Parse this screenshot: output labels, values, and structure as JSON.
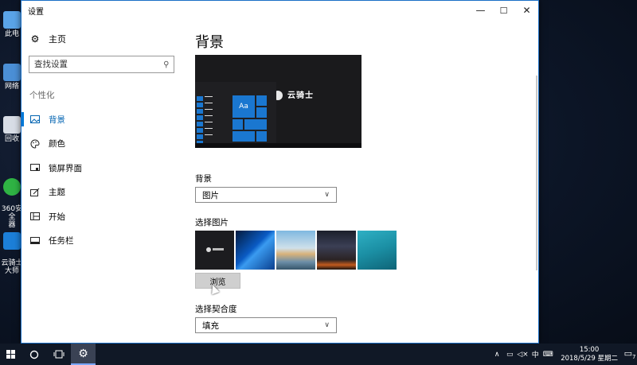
{
  "window": {
    "title": "设置",
    "controls": [
      "minimize-icon",
      "maximize-icon",
      "close-icon"
    ]
  },
  "sidebar": {
    "home_label": "主页",
    "search_placeholder": "查找设置",
    "section_label": "个性化",
    "items": [
      {
        "label": "背景",
        "icon": "picture-icon",
        "active": true
      },
      {
        "label": "颜色",
        "icon": "palette-icon",
        "active": false
      },
      {
        "label": "锁屏界面",
        "icon": "lock-screen-icon",
        "active": false
      },
      {
        "label": "主题",
        "icon": "theme-brush-icon",
        "active": false
      },
      {
        "label": "开始",
        "icon": "start-grid-icon",
        "active": false
      },
      {
        "label": "任务栏",
        "icon": "taskbar-icon",
        "active": false
      }
    ]
  },
  "content": {
    "page_title": "背景",
    "preview_logo_text": "云骑士",
    "preview_tile_text": "Aa",
    "background_label": "背景",
    "background_value": "图片",
    "choose_picture_label": "选择图片",
    "thumbnails": [
      "dark-logo-wallpaper",
      "windows-blue-wallpaper",
      "beach-rock-wallpaper",
      "night-sky-wallpaper",
      "underwater-wallpaper"
    ],
    "browse_label": "浏览",
    "fit_label": "选择契合度",
    "fit_value": "填充"
  },
  "desktop_icons": [
    {
      "label": "此电"
    },
    {
      "label": "网络"
    },
    {
      "label": "回收"
    },
    {
      "label": "360安全\n器"
    },
    {
      "label": "云骑士\n大师"
    }
  ],
  "taskbar": {
    "time": "15:00",
    "date": "2018/5/29 星期二",
    "ime": "中",
    "notification_count": "7"
  },
  "colors": {
    "accent": "#0078d7",
    "window_border": "#1a6fc6",
    "taskbar": "#101826"
  }
}
